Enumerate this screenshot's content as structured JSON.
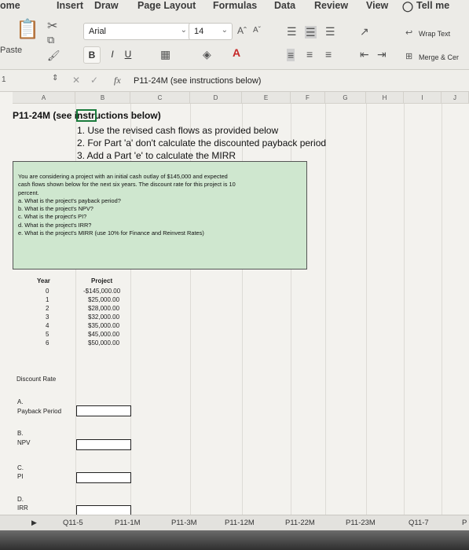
{
  "ribbon": {
    "tabs": [
      "ome",
      "Insert",
      "Draw",
      "Page Layout",
      "Formulas",
      "Data",
      "Review",
      "View",
      "Tell me"
    ],
    "paste_label": "Paste",
    "font_name": "Arial",
    "font_size": "14",
    "bold": "B",
    "italic": "I",
    "underline": "U",
    "wrap_text": "Wrap Text",
    "merge_center": "Merge & Cer"
  },
  "formula_bar": {
    "row_indicator": "1",
    "fx": "fx",
    "content": "P11-24M (see instructions below)"
  },
  "columns": [
    "A",
    "B",
    "C",
    "D",
    "E",
    "F",
    "G",
    "H",
    "I",
    "J"
  ],
  "sheet": {
    "title": "P11-24M (see instructions below)",
    "instructions": [
      "1. Use the revised cash flows as provided below",
      "2. For Part 'a' don't calculate the discounted payback period",
      "3. Add a Part 'e' to calculate the MIRR"
    ],
    "problem": [
      "You are considering a project with an initial cash outlay of $145,000 and expected",
      "cash flows shown below for the next six years. The discount rate for this project is 10",
      "percent.",
      "a. What is the project's payback period?",
      "b. What is the project's NPV?",
      "c. What is the project's PI?",
      "d. What is the project's IRR?",
      "e. What is the project's MIRR (use 10% for Finance and Reinvest Rates)"
    ],
    "year_header": "Year",
    "project_header": "Project",
    "years": [
      "0",
      "1",
      "2",
      "3",
      "4",
      "5",
      "6"
    ],
    "cash_flows": [
      "-$145,000.00",
      "$25,000.00",
      "$28,000.00",
      "$32,000.00",
      "$35,000.00",
      "$45,000.00",
      "$50,000.00"
    ],
    "discount_rate_label": "Discount Rate",
    "parts": [
      {
        "letter": "A.",
        "label": "Payback Period"
      },
      {
        "letter": "B.",
        "label": "NPV"
      },
      {
        "letter": "C.",
        "label": "PI"
      },
      {
        "letter": "D.",
        "label": "IRR"
      }
    ]
  },
  "sheet_tabs": [
    "Q11-5",
    "P11-1M",
    "P11-3M",
    "P11-12M",
    "P11-22M",
    "P11-23M",
    "Q11-7",
    "P"
  ]
}
